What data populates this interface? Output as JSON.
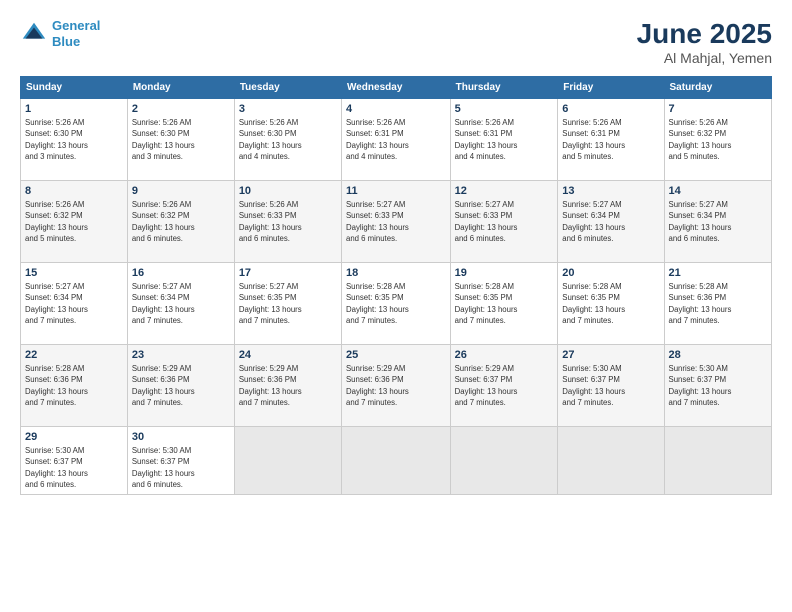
{
  "header": {
    "logo_line1": "General",
    "logo_line2": "Blue",
    "title": "June 2025",
    "location": "Al Mahjal, Yemen"
  },
  "weekdays": [
    "Sunday",
    "Monday",
    "Tuesday",
    "Wednesday",
    "Thursday",
    "Friday",
    "Saturday"
  ],
  "weeks": [
    [
      {
        "day": 1,
        "sunrise": "5:26 AM",
        "sunset": "6:30 PM",
        "daylight": "13 hours and 3 minutes."
      },
      {
        "day": 2,
        "sunrise": "5:26 AM",
        "sunset": "6:30 PM",
        "daylight": "13 hours and 3 minutes."
      },
      {
        "day": 3,
        "sunrise": "5:26 AM",
        "sunset": "6:30 PM",
        "daylight": "13 hours and 4 minutes."
      },
      {
        "day": 4,
        "sunrise": "5:26 AM",
        "sunset": "6:31 PM",
        "daylight": "13 hours and 4 minutes."
      },
      {
        "day": 5,
        "sunrise": "5:26 AM",
        "sunset": "6:31 PM",
        "daylight": "13 hours and 4 minutes."
      },
      {
        "day": 6,
        "sunrise": "5:26 AM",
        "sunset": "6:31 PM",
        "daylight": "13 hours and 5 minutes."
      },
      {
        "day": 7,
        "sunrise": "5:26 AM",
        "sunset": "6:32 PM",
        "daylight": "13 hours and 5 minutes."
      }
    ],
    [
      {
        "day": 8,
        "sunrise": "5:26 AM",
        "sunset": "6:32 PM",
        "daylight": "13 hours and 5 minutes."
      },
      {
        "day": 9,
        "sunrise": "5:26 AM",
        "sunset": "6:32 PM",
        "daylight": "13 hours and 6 minutes."
      },
      {
        "day": 10,
        "sunrise": "5:26 AM",
        "sunset": "6:33 PM",
        "daylight": "13 hours and 6 minutes."
      },
      {
        "day": 11,
        "sunrise": "5:27 AM",
        "sunset": "6:33 PM",
        "daylight": "13 hours and 6 minutes."
      },
      {
        "day": 12,
        "sunrise": "5:27 AM",
        "sunset": "6:33 PM",
        "daylight": "13 hours and 6 minutes."
      },
      {
        "day": 13,
        "sunrise": "5:27 AM",
        "sunset": "6:34 PM",
        "daylight": "13 hours and 6 minutes."
      },
      {
        "day": 14,
        "sunrise": "5:27 AM",
        "sunset": "6:34 PM",
        "daylight": "13 hours and 6 minutes."
      }
    ],
    [
      {
        "day": 15,
        "sunrise": "5:27 AM",
        "sunset": "6:34 PM",
        "daylight": "13 hours and 7 minutes."
      },
      {
        "day": 16,
        "sunrise": "5:27 AM",
        "sunset": "6:34 PM",
        "daylight": "13 hours and 7 minutes."
      },
      {
        "day": 17,
        "sunrise": "5:27 AM",
        "sunset": "6:35 PM",
        "daylight": "13 hours and 7 minutes."
      },
      {
        "day": 18,
        "sunrise": "5:28 AM",
        "sunset": "6:35 PM",
        "daylight": "13 hours and 7 minutes."
      },
      {
        "day": 19,
        "sunrise": "5:28 AM",
        "sunset": "6:35 PM",
        "daylight": "13 hours and 7 minutes."
      },
      {
        "day": 20,
        "sunrise": "5:28 AM",
        "sunset": "6:35 PM",
        "daylight": "13 hours and 7 minutes."
      },
      {
        "day": 21,
        "sunrise": "5:28 AM",
        "sunset": "6:36 PM",
        "daylight": "13 hours and 7 minutes."
      }
    ],
    [
      {
        "day": 22,
        "sunrise": "5:28 AM",
        "sunset": "6:36 PM",
        "daylight": "13 hours and 7 minutes."
      },
      {
        "day": 23,
        "sunrise": "5:29 AM",
        "sunset": "6:36 PM",
        "daylight": "13 hours and 7 minutes."
      },
      {
        "day": 24,
        "sunrise": "5:29 AM",
        "sunset": "6:36 PM",
        "daylight": "13 hours and 7 minutes."
      },
      {
        "day": 25,
        "sunrise": "5:29 AM",
        "sunset": "6:36 PM",
        "daylight": "13 hours and 7 minutes."
      },
      {
        "day": 26,
        "sunrise": "5:29 AM",
        "sunset": "6:37 PM",
        "daylight": "13 hours and 7 minutes."
      },
      {
        "day": 27,
        "sunrise": "5:30 AM",
        "sunset": "6:37 PM",
        "daylight": "13 hours and 7 minutes."
      },
      {
        "day": 28,
        "sunrise": "5:30 AM",
        "sunset": "6:37 PM",
        "daylight": "13 hours and 7 minutes."
      }
    ],
    [
      {
        "day": 29,
        "sunrise": "5:30 AM",
        "sunset": "6:37 PM",
        "daylight": "13 hours and 6 minutes."
      },
      {
        "day": 30,
        "sunrise": "5:30 AM",
        "sunset": "6:37 PM",
        "daylight": "13 hours and 6 minutes."
      },
      null,
      null,
      null,
      null,
      null
    ]
  ]
}
